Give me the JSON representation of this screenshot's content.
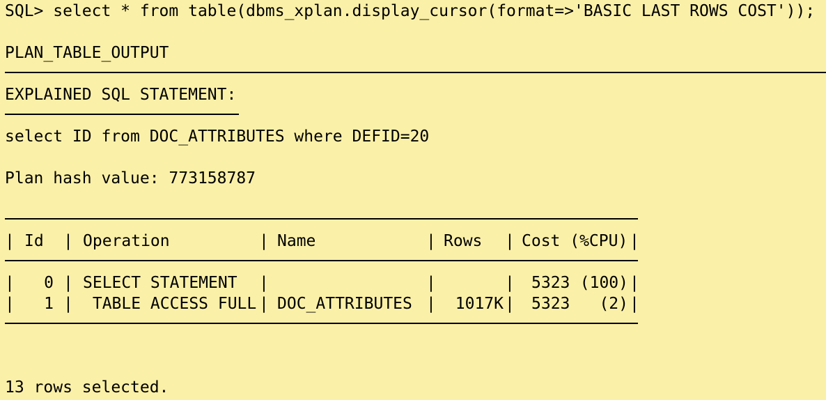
{
  "terminal": {
    "command": "SQL> select * from table(dbms_xplan.display_cursor(format=>'BASIC LAST ROWS COST'));",
    "output_header": "PLAN_TABLE_OUTPUT",
    "section_title": "EXPLAINED SQL STATEMENT:",
    "sql_statement": "select ID from DOC_ATTRIBUTES where DEFID=20",
    "plan_hash": "Plan hash value: 773158787",
    "plan_table": {
      "separator": "|",
      "columns": [
        {
          "key": "id",
          "label": "Id"
        },
        {
          "key": "operation",
          "label": "Operation"
        },
        {
          "key": "name",
          "label": "Name"
        },
        {
          "key": "rows",
          "label": "Rows"
        },
        {
          "key": "cost",
          "label": "Cost (%CPU)"
        }
      ],
      "rows": [
        {
          "id": "0",
          "operation": "SELECT STATEMENT",
          "name": "",
          "rows": "",
          "cost": "5323",
          "cpu": "(100)"
        },
        {
          "id": "1",
          "operation": " TABLE ACCESS FULL",
          "name": "DOC_ATTRIBUTES",
          "rows": "1017K",
          "cost": "5323",
          "cpu": "(2)"
        }
      ]
    },
    "footer": "13 rows selected."
  }
}
